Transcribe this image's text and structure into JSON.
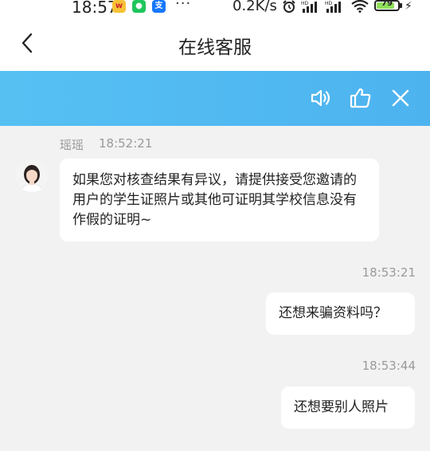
{
  "status_bar": {
    "time": "18:57",
    "more": "···",
    "net_speed": "0.2K/s",
    "battery_level": "79",
    "icons": [
      "weibo-icon",
      "wechat-icon",
      "alipay-icon",
      "alarm-icon",
      "signal-hd-icon",
      "signal-hd-icon",
      "wifi-icon",
      "battery-icon",
      "charging-icon"
    ]
  },
  "header": {
    "title": "在线客服",
    "back_icon": "chevron-left-icon"
  },
  "banner": {
    "color": "#4db3ef",
    "actions": [
      "speaker-icon",
      "thumbs-up-icon",
      "close-icon"
    ]
  },
  "chat": {
    "agent_name": "瑶瑶",
    "agent_time": "18:52:21",
    "agent_message": "如果您对核查结果有异议，请提供接受您邀请的用户的学生证照片或其他可证明其学校信息没有作假的证明~",
    "user_messages": [
      {
        "time": "18:53:21",
        "text": "还想来骗资料吗？"
      },
      {
        "time": "18:53:44",
        "text": "还想要别人照片"
      }
    ]
  }
}
